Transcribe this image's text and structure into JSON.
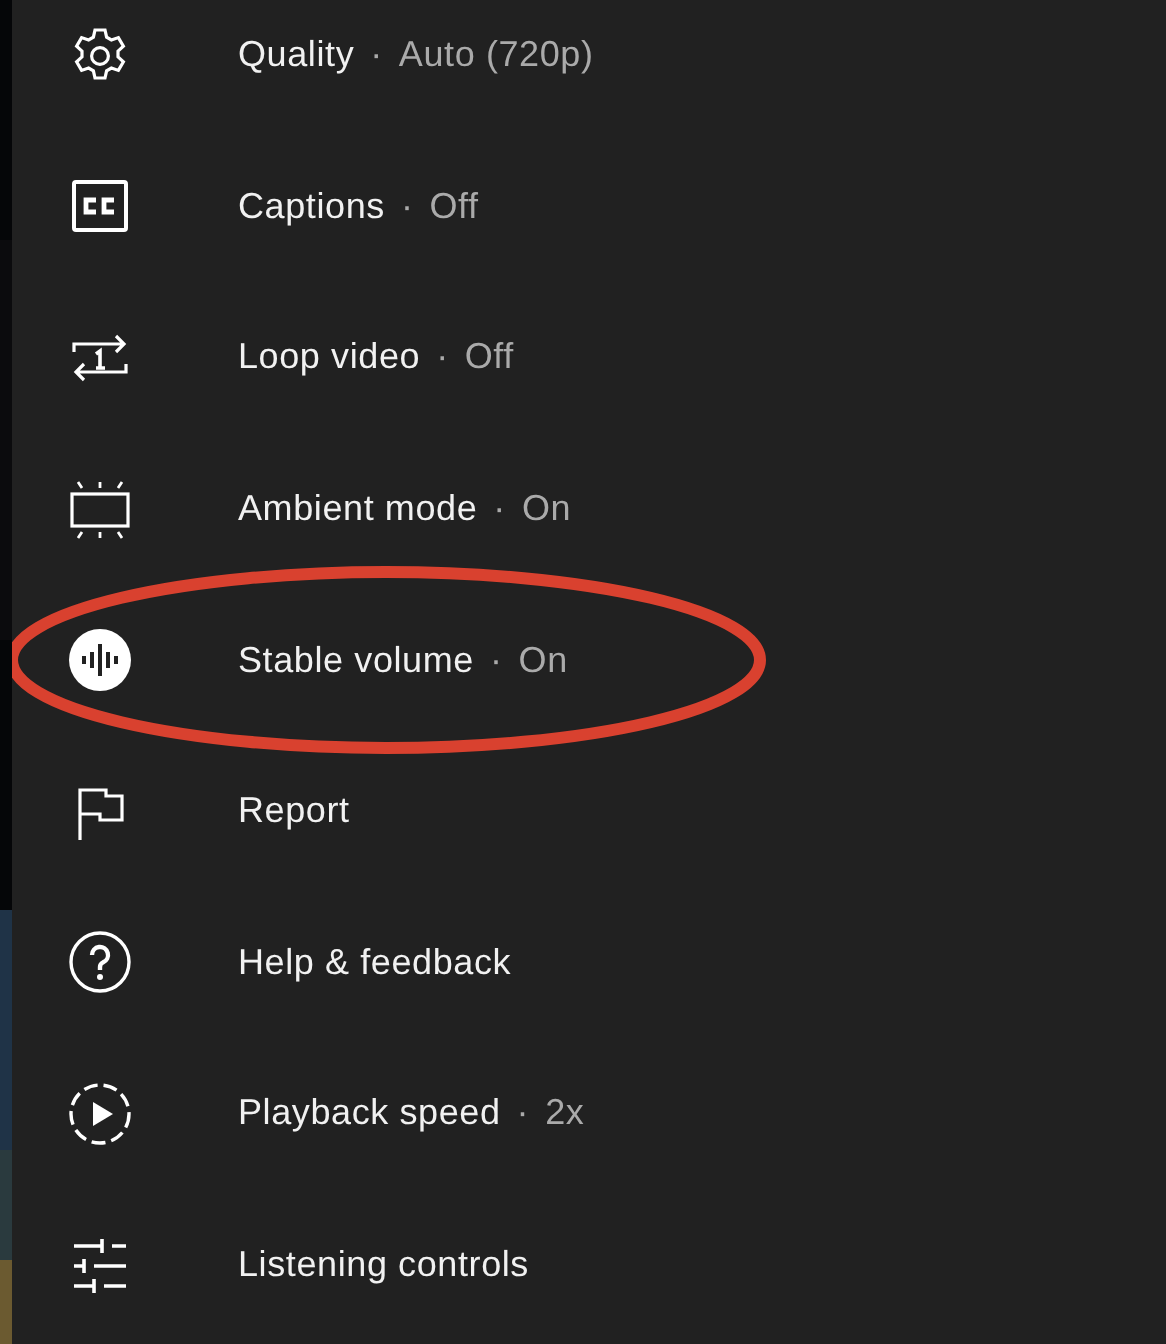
{
  "menu": {
    "items": [
      {
        "kind": "gear",
        "label": "Quality",
        "separator": "·",
        "value": "Auto (720p)",
        "circled": false
      },
      {
        "kind": "captions",
        "label": "Captions",
        "separator": "·",
        "value": "Off",
        "circled": false
      },
      {
        "kind": "loop",
        "label": "Loop video",
        "separator": "·",
        "value": "Off",
        "circled": false
      },
      {
        "kind": "ambient",
        "label": "Ambient mode",
        "separator": "·",
        "value": "On",
        "circled": false
      },
      {
        "kind": "waveform",
        "label": "Stable volume",
        "separator": "·",
        "value": "On",
        "circled": true
      },
      {
        "kind": "flag",
        "label": "Report",
        "circled": false
      },
      {
        "kind": "help",
        "label": "Help & feedback",
        "circled": false
      },
      {
        "kind": "speed",
        "label": "Playback speed",
        "separator": "·",
        "value": "2x",
        "circled": false
      },
      {
        "kind": "sliders",
        "label": "Listening controls",
        "circled": false
      }
    ]
  }
}
